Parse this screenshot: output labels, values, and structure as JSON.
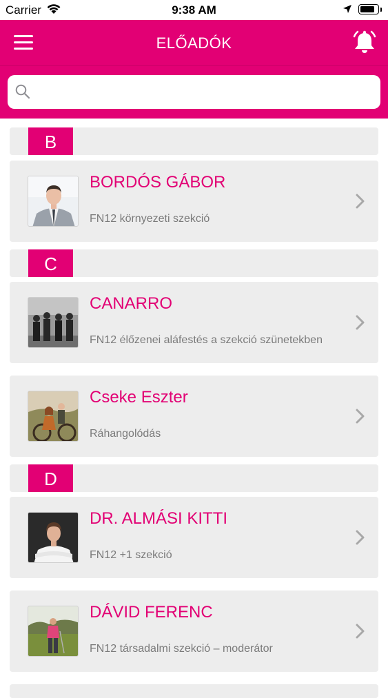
{
  "status_bar": {
    "carrier": "Carrier",
    "time": "9:38 AM",
    "battery_level": 0.85
  },
  "nav": {
    "title": "ELŐADÓK",
    "menu_icon": "hamburger-menu-icon",
    "bell_icon": "bell-icon"
  },
  "search": {
    "placeholder": "",
    "value": "",
    "icon": "search-icon"
  },
  "colors": {
    "brand": "#e20074",
    "card_bg": "#ededed",
    "subtitle": "#7a7a7a"
  },
  "sections": [
    {
      "letter": "B",
      "items": [
        {
          "name": "BORDÓS GÁBOR",
          "subtitle": "FN12 környezeti szekció"
        }
      ]
    },
    {
      "letter": "C",
      "items": [
        {
          "name": "CANARRO",
          "subtitle": "FN12 élőzenei aláfestés a szekció szünetekben"
        },
        {
          "name": "Cseke Eszter",
          "subtitle": "Ráhangolódás"
        }
      ]
    },
    {
      "letter": "D",
      "items": [
        {
          "name": "DR. ALMÁSI KITTI",
          "subtitle": "FN12 +1 szekció"
        },
        {
          "name": "DÁVID FERENC",
          "subtitle": "FN12 társadalmi szekció – moderátor"
        }
      ]
    }
  ]
}
